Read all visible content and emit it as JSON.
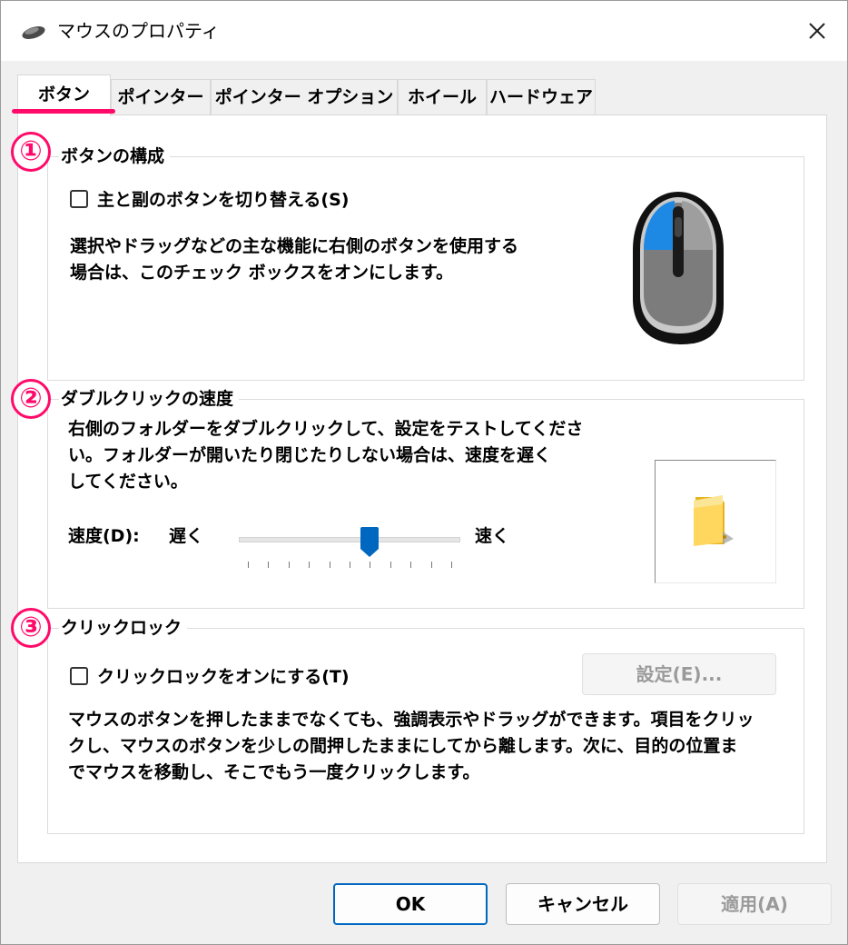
{
  "window": {
    "title": "マウスのプロパティ",
    "app_icon": "mouse-icon"
  },
  "tabs": [
    "ボタン",
    "ポインター",
    "ポインター オプション",
    "ホイール",
    "ハードウェア"
  ],
  "colors": {
    "annotation": "#ff0a6a",
    "accent": "#0067c0",
    "mouse_highlight": "#1e88e5"
  },
  "annotations": [
    "①",
    "②",
    "③"
  ],
  "button_config": {
    "title": "ボタンの構成",
    "checkbox_label": "主と副のボタンを切り替える(S)",
    "checked": false,
    "desc_line1": "選択やドラッグなどの主な機能に右側のボタンを使用する",
    "desc_line2": "場合は、このチェック ボックスをオンにします。"
  },
  "double_click": {
    "title": "ダブルクリックの速度",
    "desc_line1": "右側のフォルダーをダブルクリックして、設定をテストしてくださ",
    "desc_line2": "い。フォルダーが開いたり閉じたりしない場合は、速度を遅く",
    "desc_line3": "してください。",
    "speed_label": "速度(D):",
    "slow_label": "遅く",
    "fast_label": "速く",
    "slider_value": 0.6
  },
  "click_lock": {
    "title": "クリックロック",
    "checkbox_label": "クリックロックをオンにする(T)",
    "checked": false,
    "settings_button": "設定(E)...",
    "desc_line1": "マウスのボタンを押したままでなくても、強調表示やドラッグができます。項目をクリッ",
    "desc_line2": "クし、マウスのボタンを少しの間押したままにしてから離します。次に、目的の位置ま",
    "desc_line3": "でマウスを移動し、そこでもう一度クリックします。"
  },
  "footer": {
    "ok": "OK",
    "cancel": "キャンセル",
    "apply": "適用(A)"
  }
}
